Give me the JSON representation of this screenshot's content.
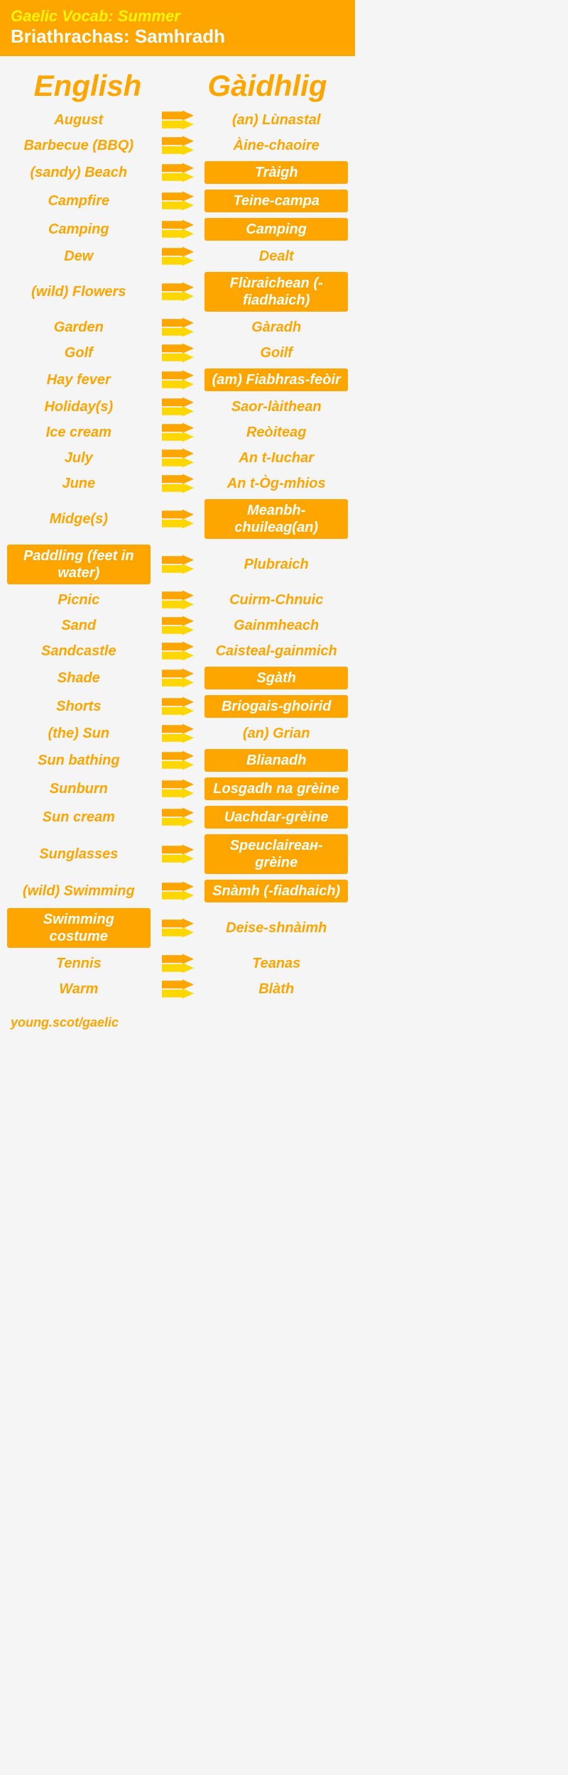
{
  "header": {
    "title": "Gaelic Vocab: Summer",
    "subtitle": "Briathrachas: Samhradh"
  },
  "columns": {
    "english_label": "English",
    "gaelic_label": "Gàidhlig"
  },
  "vocab": [
    {
      "english": "August",
      "gaelic": "(an) Lùnastal",
      "eng_hl": false,
      "gae_hl": false
    },
    {
      "english": "Barbecue (BBQ)",
      "gaelic": "Àine-chaoire",
      "eng_hl": false,
      "gae_hl": false
    },
    {
      "english": "(sandy) Beach",
      "gaelic": "Tràigh",
      "eng_hl": false,
      "gae_hl": true
    },
    {
      "english": "Campfire",
      "gaelic": "Teine-campa",
      "eng_hl": false,
      "gae_hl": true
    },
    {
      "english": "Camping",
      "gaelic": "Camping",
      "eng_hl": false,
      "gae_hl": true
    },
    {
      "english": "Dew",
      "gaelic": "Dealt",
      "eng_hl": false,
      "gae_hl": false
    },
    {
      "english": "(wild) Flowers",
      "gaelic": "Flùraichean (-fiadhaich)",
      "eng_hl": false,
      "gae_hl": true
    },
    {
      "english": "Garden",
      "gaelic": "Gàradh",
      "eng_hl": false,
      "gae_hl": false
    },
    {
      "english": "Golf",
      "gaelic": "Goilf",
      "eng_hl": false,
      "gae_hl": false
    },
    {
      "english": "Hay fever",
      "gaelic": "(am) Fiabhras-feòir",
      "eng_hl": false,
      "gae_hl": true
    },
    {
      "english": "Holiday(s)",
      "gaelic": "Saor-làithean",
      "eng_hl": false,
      "gae_hl": false
    },
    {
      "english": "Ice cream",
      "gaelic": "Reòiteag",
      "eng_hl": false,
      "gae_hl": false
    },
    {
      "english": "July",
      "gaelic": "An t-Iuchar",
      "eng_hl": false,
      "gae_hl": false
    },
    {
      "english": "June",
      "gaelic": "An t-Òg-mhios",
      "eng_hl": false,
      "gae_hl": false
    },
    {
      "english": "Midge(s)",
      "gaelic": "Meanbh-chuileag(an)",
      "eng_hl": false,
      "gae_hl": true
    },
    {
      "english": "Paddling (feet in water)",
      "gaelic": "Plubraich",
      "eng_hl": true,
      "gae_hl": false
    },
    {
      "english": "Picnic",
      "gaelic": "Cuirm-Chnuic",
      "eng_hl": false,
      "gae_hl": false
    },
    {
      "english": "Sand",
      "gaelic": "Gainmheach",
      "eng_hl": false,
      "gae_hl": false
    },
    {
      "english": "Sandcastle",
      "gaelic": "Caisteal-gainmich",
      "eng_hl": false,
      "gae_hl": false
    },
    {
      "english": "Shade",
      "gaelic": "Sgàth",
      "eng_hl": false,
      "gae_hl": true
    },
    {
      "english": "Shorts",
      "gaelic": "Briogais-ghoirid",
      "eng_hl": false,
      "gae_hl": true
    },
    {
      "english": "(the) Sun",
      "gaelic": "(an) Grian",
      "eng_hl": false,
      "gae_hl": false
    },
    {
      "english": "Sun bathing",
      "gaelic": "Blianadh",
      "eng_hl": false,
      "gae_hl": true
    },
    {
      "english": "Sunburn",
      "gaelic": "Losgadh na grèine",
      "eng_hl": false,
      "gae_hl": true
    },
    {
      "english": "Sun cream",
      "gaelic": "Uachdar-grèine",
      "eng_hl": false,
      "gae_hl": true
    },
    {
      "english": "Sunglasses",
      "gaelic": "Speuclaireан-grèine",
      "eng_hl": false,
      "gae_hl": true
    },
    {
      "english": "(wild) Swimming",
      "gaelic": "Snàmh (-fiadhaich)",
      "eng_hl": false,
      "gae_hl": true
    },
    {
      "english": "Swimming costume",
      "gaelic": "Deise-shnàimh",
      "eng_hl": true,
      "gae_hl": false
    },
    {
      "english": "Tennis",
      "gaelic": "Teanas",
      "eng_hl": false,
      "gae_hl": false
    },
    {
      "english": "Warm",
      "gaelic": "Blàth",
      "eng_hl": false,
      "gae_hl": false
    }
  ],
  "footer": {
    "text": "young.scot/gaelic"
  }
}
